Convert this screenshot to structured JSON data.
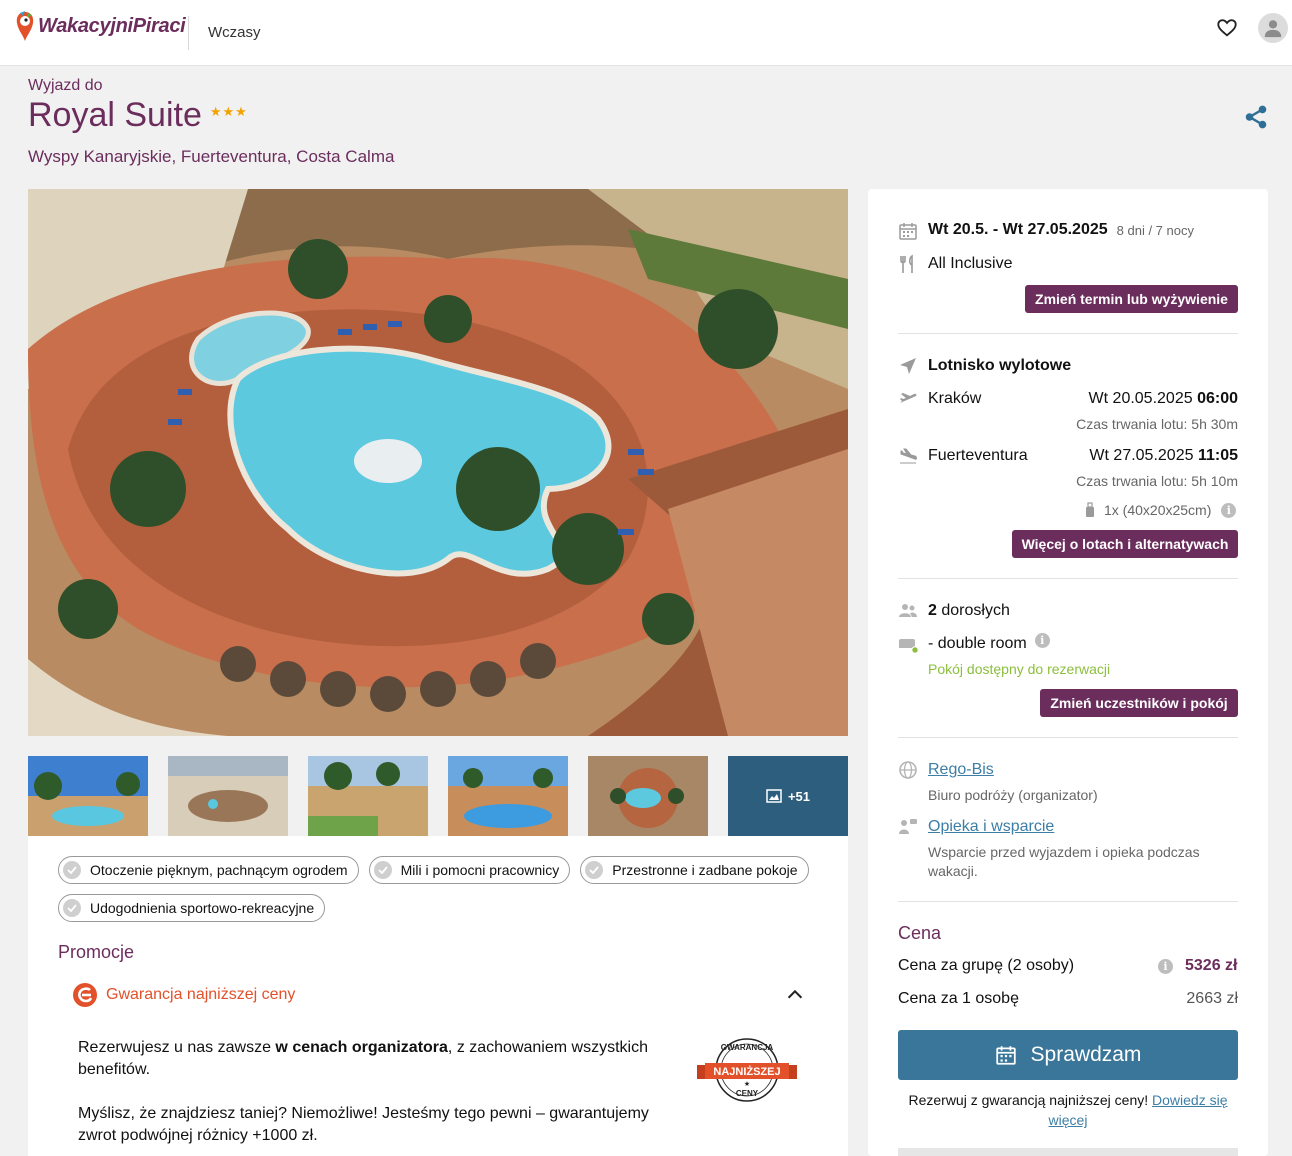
{
  "header": {
    "logo_text": "WakacyjniPiraci",
    "nav_item": "Wczasy",
    "icons": [
      "heart-icon",
      "user-icon"
    ]
  },
  "hotel": {
    "trip_label": "Wyjazd do",
    "name": "Royal Suite",
    "stars": "★★★",
    "location": "Wyspy Kanaryjskie, Fuerteventura, Costa Calma"
  },
  "gallery": {
    "more_count": "+51"
  },
  "tags": [
    "Otoczenie pięknym, pachnącym ogrodem",
    "Mili i pomocni pracownicy",
    "Przestronne i zadbane pokoje",
    "Udogodnienia sportowo-rekreacyjne"
  ],
  "promo": {
    "title": "Promocje",
    "item": "Gwarancja najniższej ceny",
    "p1_a": "Rezerwujesz u nas zawsze ",
    "p1_b": "w cenach organizatora",
    "p1_c": ", z zachowaniem wszystkich benefitów.",
    "p2": "Myślisz, że znajdziesz taniej? Niemożliwe! Jesteśmy tego pewni – gwarantujemy zwrot podwójnej różnicy +1000 zł.",
    "badge_top": "GWARANCJA",
    "badge_mid": "NAJNIŻSZEJ",
    "badge_bottom": "CENY"
  },
  "panel": {
    "dates": "Wt 20.5. - Wt 27.05.2025",
    "duration": "8 dni / 7 nocy",
    "board": "All Inclusive",
    "change_term_btn": "Zmień termin lub wyżywienie",
    "airport_title": "Lotnisko wylotowe",
    "out_city": "Kraków",
    "out_date": "Wt 20.05.2025",
    "out_time": "06:00",
    "out_duration": "Czas trwania lotu: 5h 30m",
    "ret_city": "Fuerteventura",
    "ret_date": "Wt 27.05.2025",
    "ret_time": "11:05",
    "ret_duration": "Czas trwania lotu: 5h 10m",
    "luggage": "1x (40x20x25cm)",
    "flights_btn": "Więcej o lotach i alternatywach",
    "adults_count": "2",
    "adults_label": "dorosłych",
    "room": "- double room",
    "room_status": "Pokój dostępny do rezerwacji",
    "change_people_btn": "Zmień uczestników i pokój",
    "organizer_link": "Rego-Bis",
    "organizer_desc": "Biuro podróży (organizator)",
    "support_link": "Opieka i wsparcie",
    "support_desc": "Wsparcie przed wyjazdem i opieka podczas wakacji.",
    "price_title": "Cena",
    "group_label": "Cena za grupę (2 osoby)",
    "group_price": "5326 zł",
    "person_label": "Cena za 1 osobę",
    "person_price": "2663 zł",
    "cta": "Sprawdzam",
    "note_a": "Rezerwuj z gwarancją najniższej ceny! ",
    "note_link": "Dowiedz się więcej"
  },
  "colors": {
    "brand": "#6b2d5c",
    "cta": "#3a7699",
    "accent_orange": "#e2512a",
    "available_green": "#8bbf3c",
    "stars": "#f2a300"
  }
}
